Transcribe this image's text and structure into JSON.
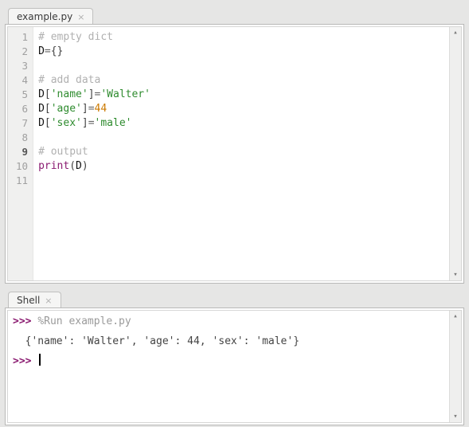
{
  "editor": {
    "tab_label": "example.py",
    "lines": [
      {
        "n": "1",
        "tokens": [
          {
            "cls": "c-comment",
            "t": "# empty dict"
          }
        ]
      },
      {
        "n": "2",
        "tokens": [
          {
            "cls": "c-name",
            "t": "D"
          },
          {
            "cls": "c-op",
            "t": "="
          },
          {
            "cls": "c-punct",
            "t": "{}"
          }
        ]
      },
      {
        "n": "3",
        "tokens": []
      },
      {
        "n": "4",
        "tokens": [
          {
            "cls": "c-comment",
            "t": "# add data"
          }
        ]
      },
      {
        "n": "5",
        "tokens": [
          {
            "cls": "c-name",
            "t": "D"
          },
          {
            "cls": "c-punct",
            "t": "["
          },
          {
            "cls": "c-string",
            "t": "'name'"
          },
          {
            "cls": "c-punct",
            "t": "]"
          },
          {
            "cls": "c-op",
            "t": "="
          },
          {
            "cls": "c-string",
            "t": "'Walter'"
          }
        ]
      },
      {
        "n": "6",
        "tokens": [
          {
            "cls": "c-name",
            "t": "D"
          },
          {
            "cls": "c-punct",
            "t": "["
          },
          {
            "cls": "c-string",
            "t": "'age'"
          },
          {
            "cls": "c-punct",
            "t": "]"
          },
          {
            "cls": "c-op",
            "t": "="
          },
          {
            "cls": "c-number",
            "t": "44"
          }
        ]
      },
      {
        "n": "7",
        "tokens": [
          {
            "cls": "c-name",
            "t": "D"
          },
          {
            "cls": "c-punct",
            "t": "["
          },
          {
            "cls": "c-string",
            "t": "'sex'"
          },
          {
            "cls": "c-punct",
            "t": "]"
          },
          {
            "cls": "c-op",
            "t": "="
          },
          {
            "cls": "c-string",
            "t": "'male'"
          }
        ]
      },
      {
        "n": "8",
        "tokens": []
      },
      {
        "n": "9",
        "active": true,
        "tokens": [
          {
            "cls": "c-comment",
            "t": "# output"
          }
        ]
      },
      {
        "n": "10",
        "tokens": [
          {
            "cls": "c-func",
            "t": "print"
          },
          {
            "cls": "c-punct",
            "t": "("
          },
          {
            "cls": "c-name",
            "t": "D"
          },
          {
            "cls": "c-punct",
            "t": ")"
          }
        ]
      },
      {
        "n": "11",
        "tokens": []
      }
    ]
  },
  "shell": {
    "tab_label": "Shell",
    "lines": [
      {
        "tokens": [
          {
            "cls": "c-prompt",
            "t": ">>> "
          },
          {
            "cls": "c-runcmd",
            "t": "%Run example.py"
          }
        ]
      },
      {
        "tokens": [
          {
            "cls": "c-out",
            "t": "  {'name': 'Walter', 'age': 44, 'sex': 'male'}"
          }
        ]
      },
      {
        "tokens": [
          {
            "cls": "c-prompt",
            "t": ">>> "
          }
        ],
        "cursor": true
      }
    ]
  },
  "scrollbar": {
    "up": "▴",
    "down": "▾"
  }
}
